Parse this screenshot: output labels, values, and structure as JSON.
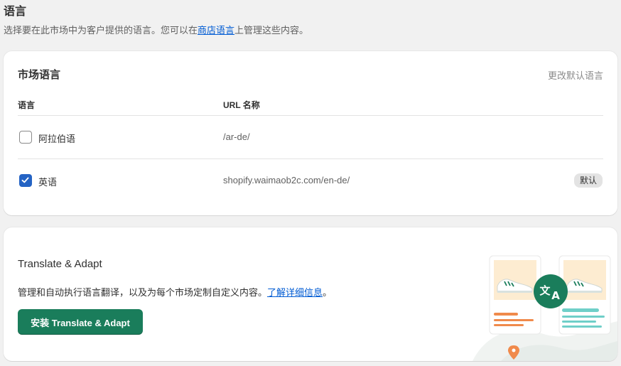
{
  "section": {
    "title": "语言",
    "desc_before": "选择要在此市场中为客户提供的语言。您可以在",
    "desc_link": "商店语言",
    "desc_after": "上管理这些内容。"
  },
  "market_languages": {
    "title": "市场语言",
    "action": "更改默认语言",
    "columns": {
      "language": "语言",
      "url": "URL 名称"
    },
    "rows": [
      {
        "name": "阿拉伯语",
        "url": "/ar-de/",
        "checked": false,
        "badge": ""
      },
      {
        "name": "英语",
        "url": "shopify.waimaob2c.com/en-de/",
        "checked": true,
        "badge": "默认"
      }
    ]
  },
  "translate_adapt": {
    "title": "Translate & Adapt",
    "desc": "管理和自动执行语言翻译，以及为每个市场定制自定义内容。",
    "link": "了解详细信息",
    "period": "。",
    "button": "安装 Translate & Adapt"
  },
  "colors": {
    "accent": "#1a7d5b",
    "link": "#005bd3",
    "checkbox": "#2463c4"
  },
  "icons": [
    "checkmark-icon",
    "translate-icon",
    "sneaker-icon",
    "location-pin-icon"
  ]
}
